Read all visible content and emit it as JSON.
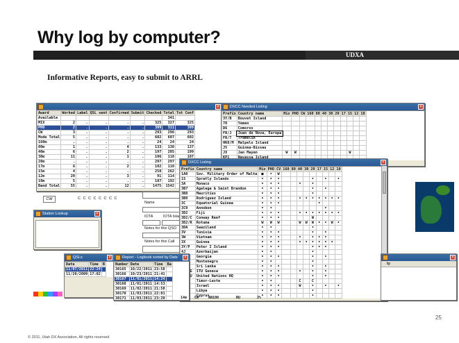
{
  "slide": {
    "title": "Why log by computer?",
    "band_label": "UDXA",
    "subtitle": "Informative Reports, easy to submit to ARRL",
    "footer": "© 2011, Utah DX Association, All rights reserved",
    "page_number": "25"
  },
  "awards_window": {
    "headers": [
      "Award",
      "Worked",
      "Label",
      "QSL sent",
      "Confirmed",
      "Submit",
      "Checked",
      "Total",
      "Tot Conf"
    ],
    "rows": [
      [
        "Available",
        "",
        "",
        "",
        "",
        "",
        "",
        "341",
        ""
      ],
      [
        "MIX",
        "2",
        ".",
        ".",
        ".",
        ".",
        "325",
        "327",
        "325"
      ],
      [
        "PHO",
        "2",
        ".",
        ".",
        ".",
        ".",
        "309",
        "311",
        "309"
      ],
      [
        "CW",
        "3",
        ".",
        ".",
        ".",
        ".",
        "293",
        "296",
        "293"
      ],
      [
        "Mode Total",
        "5",
        ".",
        ".",
        ".",
        ".",
        "602",
        "607",
        "602"
      ],
      [
        "160m",
        ".",
        ".",
        ".",
        ".",
        ".",
        "24",
        "24",
        "24"
      ],
      [
        "80m",
        "1",
        ".",
        ".",
        "4",
        ".",
        "133",
        "138",
        "137"
      ],
      [
        "40m",
        "6",
        ".",
        ".",
        "2",
        ".",
        "197",
        "205",
        "199"
      ],
      [
        "30m",
        "11",
        ".",
        ".",
        "1",
        ".",
        "106",
        "118",
        "107"
      ],
      [
        "20m",
        ".",
        ".",
        ".",
        ".",
        ".",
        "297",
        "297",
        "297"
      ],
      [
        "17m",
        "6",
        ".",
        ".",
        "2",
        ".",
        "102",
        "110",
        "104"
      ],
      [
        "15m",
        "4",
        ".",
        ".",
        ".",
        ".",
        "258",
        "262",
        "258"
      ],
      [
        "12m",
        "20",
        ".",
        ".",
        "3",
        ".",
        "91",
        "114",
        "94"
      ],
      [
        "10m",
        "5",
        ".",
        ".",
        ".",
        ".",
        "187",
        "192",
        "187"
      ],
      [
        "Band Total",
        "55",
        ".",
        ".",
        "12",
        ".",
        "1475",
        "1542",
        "1487"
      ]
    ],
    "cw_label": "CW",
    "cw_cells": "C C C C C C C C"
  },
  "needed_window": {
    "title": "DXCC Needed Listing",
    "headers": [
      "Prefix",
      "Country name",
      "Mix",
      "PHO",
      "CW",
      "160",
      "80",
      "40",
      "30",
      "20",
      "17",
      "15",
      "12",
      "10"
    ],
    "rows": [
      [
        "3Y/B",
        "Bouvet Island"
      ],
      [
        "7O",
        "Yemen"
      ],
      [
        "D6",
        "Comoros"
      ],
      [
        "FR/J",
        "Juan de Nova, Europa"
      ],
      [
        "FR/T",
        "Tromelin"
      ],
      [
        "HK0/M",
        "Malpelo Island"
      ],
      [
        "J5",
        "Guinea-Bissau"
      ],
      [
        "JX",
        "Jan Mayen",
        "W",
        "W",
        "",
        "",
        "",
        "",
        "",
        "",
        "",
        "W"
      ],
      [
        "KP1",
        "Navassa Island"
      ]
    ]
  },
  "dxcc_window": {
    "title": "DXCC Listing",
    "headers": [
      "Prefix",
      "Country name",
      "Mix",
      "PHO",
      "CV",
      "160",
      "80",
      "40",
      "30",
      "20",
      "17",
      "15",
      "12",
      "10"
    ],
    "rows": [
      [
        "1A0",
        "Sov. Military Order of Malta",
        "■",
        "•",
        "W",
        "",
        "",
        "",
        "",
        "",
        "",
        "",
        "",
        ""
      ],
      [
        "1S",
        "Spratly Islands",
        "•",
        "•",
        "•",
        "",
        "",
        "",
        "",
        "•",
        "",
        "•",
        "",
        "•"
      ],
      [
        "3A",
        "Monaco",
        "•",
        "•",
        "•",
        "",
        "",
        "•",
        "",
        "•",
        "",
        "",
        "",
        ""
      ],
      [
        "3B7",
        "Agalega & Saint Brandon",
        "•",
        "•",
        "•",
        "",
        "",
        "",
        "",
        "•",
        "",
        "•",
        "",
        ""
      ],
      [
        "3B8",
        "Mauritius",
        "•",
        "•",
        "•",
        "",
        "",
        "",
        "",
        "•",
        "",
        "",
        "",
        ""
      ],
      [
        "3B9",
        "Rodriguez Island",
        "•",
        "•",
        "•",
        "",
        "",
        "•",
        "•",
        "•",
        "•",
        "•",
        "•",
        "•"
      ],
      [
        "3C",
        "Equatorial Guinea",
        "•",
        "•",
        "•",
        "",
        "",
        "",
        "",
        "",
        "•",
        "",
        "",
        ""
      ],
      [
        "3C0",
        "Annobon",
        "•",
        "•",
        "",
        "",
        "",
        "",
        "",
        "",
        "",
        "•",
        "",
        ""
      ],
      [
        "3D2",
        "Fiji",
        "•",
        "•",
        "•",
        "",
        "",
        "•",
        "•",
        "•",
        "•",
        "•",
        "•",
        "•"
      ],
      [
        "3D2/C",
        "Conway Reef",
        "•",
        "•",
        "•",
        "",
        "",
        "",
        "",
        "W",
        "",
        "",
        "",
        ""
      ],
      [
        "3D2/R",
        "Rotuma",
        "W",
        "W",
        "W",
        "",
        "",
        "W",
        "W",
        "W",
        "•",
        "•",
        "W",
        "•"
      ],
      [
        "3DA",
        "Swaziland",
        "•",
        "•",
        "",
        "",
        "",
        "",
        "",
        "•",
        "",
        "",
        "",
        ""
      ],
      [
        "3V",
        "Tunisia",
        "•",
        "•",
        "•",
        "",
        "",
        "",
        "",
        "•",
        "",
        "•",
        "",
        ""
      ],
      [
        "3W",
        "Vietnam",
        "•",
        "•",
        "•",
        "",
        "",
        "•",
        "",
        "•",
        "•",
        "•",
        "",
        ""
      ],
      [
        "3X",
        "Guinea",
        "•",
        "•",
        "•",
        "",
        "",
        "•",
        "•",
        "•",
        "•",
        "•",
        "•",
        ""
      ],
      [
        "3Y/P",
        "Peter I Island",
        "•",
        "•",
        "•",
        "",
        "",
        "",
        "",
        "•",
        "•",
        "•",
        "",
        ""
      ],
      [
        "4J",
        "Azerbaijan",
        "•",
        "•",
        "",
        "",
        "",
        "",
        "",
        "•",
        "",
        "",
        "",
        ""
      ],
      [
        "4L",
        "Georgia",
        "•",
        "•",
        "•",
        "",
        "",
        "",
        "",
        "•",
        "",
        "•",
        "",
        ""
      ],
      [
        "4O",
        "Montenegro",
        "•",
        "•",
        "",
        "",
        "",
        "",
        "",
        "•",
        "",
        "",
        "",
        ""
      ],
      [
        "4S",
        "Sri Lanka",
        "•",
        "•",
        "•",
        "",
        "",
        "",
        "",
        "•",
        "",
        "•",
        "",
        ""
      ],
      [
        "4U1/G",
        "ITU Geneva",
        "•",
        "•",
        "•",
        "",
        "",
        "•",
        "",
        "•",
        "",
        "•",
        "",
        ""
      ],
      [
        "4U1/U",
        "United Nations HQ",
        "•",
        "•",
        "•",
        "",
        "",
        "",
        "",
        "•",
        "",
        "•",
        "",
        ""
      ],
      [
        "4W",
        "Timor-Leste",
        "•",
        "•",
        "",
        "",
        "",
        "C",
        "",
        "C",
        "",
        "",
        "",
        ""
      ],
      [
        "4X",
        "Israel",
        "•",
        "•",
        "•",
        "",
        "",
        "W",
        "",
        "•",
        "",
        "•",
        "",
        "•"
      ],
      [
        "5A",
        "Libya",
        "•",
        "•",
        "•",
        "",
        "",
        "",
        "",
        "•",
        "",
        "",
        "",
        ""
      ],
      [
        "5B",
        "Cyprus",
        "•",
        "•",
        "•",
        "",
        "",
        "",
        "",
        "•",
        "",
        "",
        "",
        ""
      ]
    ]
  },
  "qso_panel": {
    "name_label": "Name",
    "iota_label": "IOTA",
    "iota_label2": "IOTA Islan",
    "notes_qso_label": "Notes for this QSO",
    "notes_call_label": "Notes for this Call"
  },
  "lookup_window": {
    "title": "Station Lookup"
  },
  "qsl_window": {
    "title": "QSLs",
    "headers": [
      "Date",
      "Time",
      "B"
    ],
    "rows": [
      [
        "11/07/2011",
        "22:24",
        ""
      ],
      [
        "11/20/2009",
        "17:02",
        ""
      ]
    ]
  },
  "report_window": {
    "title": "Report - Logbook sorted by Date",
    "headers": [
      "Number",
      "Date",
      "Time",
      "Ba"
    ],
    "rows": [
      [
        "30165",
        "10/22/2011",
        "23:58",
        ""
      ],
      [
        "30166",
        "10/23/2011",
        "21:41",
        ""
      ],
      [
        "30167",
        "11/01/2011",
        "14:24",
        ""
      ],
      [
        "30168",
        "11/01/2011",
        "14:53",
        ""
      ],
      [
        "30169",
        "11/02/2011",
        "21:58",
        ""
      ],
      [
        "30170",
        "11/03/2011",
        "22:01",
        ""
      ],
      [
        "30171",
        "11/03/2011",
        "23:20",
        ""
      ]
    ],
    "tail_row": [
      "14m",
      "CW",
      "AN100",
      "RU",
      "2%"
    ]
  },
  "right_window": {
    "label": "ty"
  },
  "colors": {
    "title_bar": "#3a6ea5",
    "window_bg": "#ece9d8",
    "selection": "#2a4e9a",
    "band": "#202020"
  }
}
